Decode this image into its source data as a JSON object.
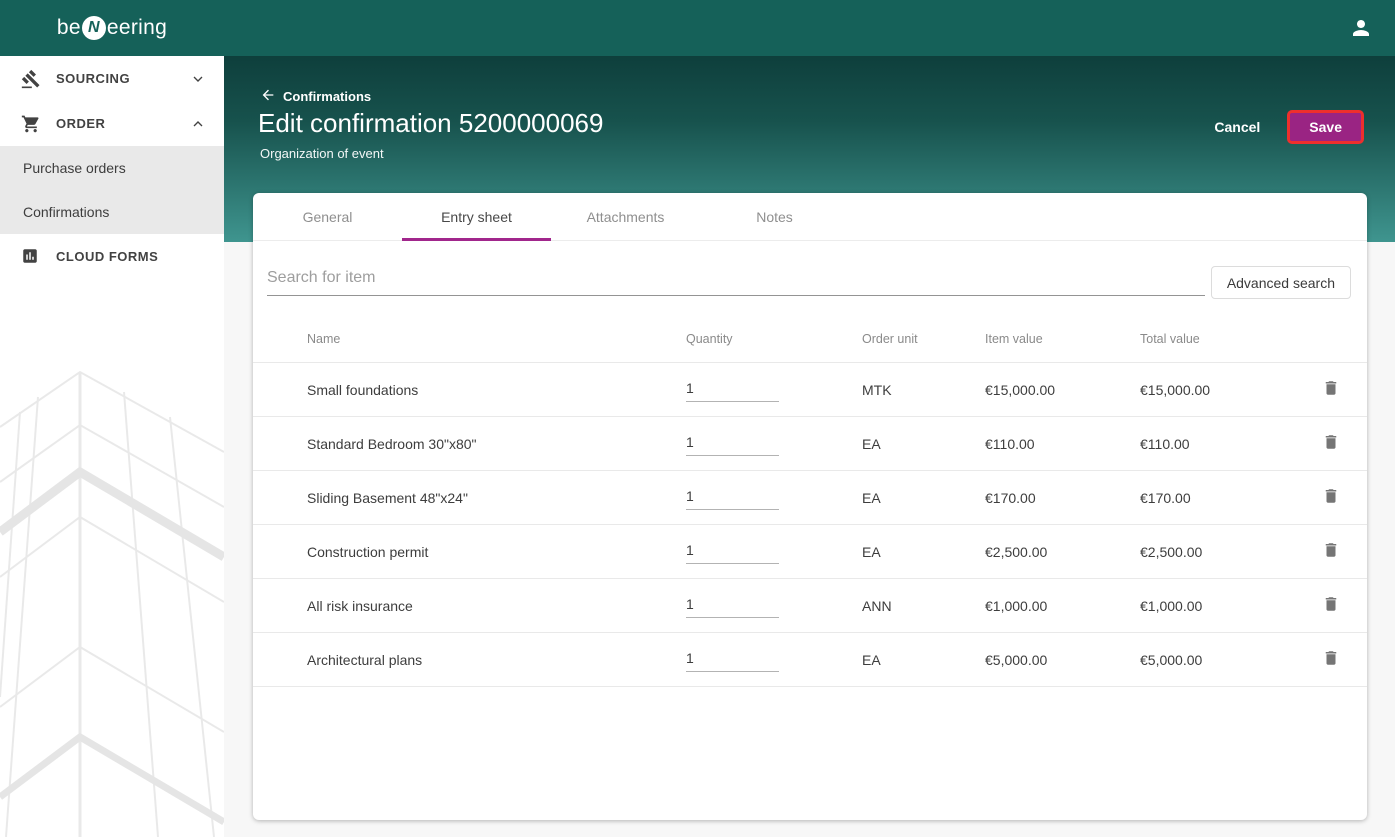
{
  "topbar": {
    "logo_pre": "be",
    "logo_mid": "N",
    "logo_post": "eering"
  },
  "sidebar": {
    "sourcing_label": "SOURCING",
    "order_label": "ORDER",
    "purchase_orders_label": "Purchase orders",
    "confirmations_label": "Confirmations",
    "cloud_forms_label": "CLOUD FORMS"
  },
  "header": {
    "back_label": "Confirmations",
    "title": "Edit confirmation 5200000069",
    "subtitle": "Organization of event",
    "cancel_label": "Cancel",
    "save_label": "Save"
  },
  "tabs": [
    {
      "label": "General",
      "active": false
    },
    {
      "label": "Entry sheet",
      "active": true
    },
    {
      "label": "Attachments",
      "active": false
    },
    {
      "label": "Notes",
      "active": false
    }
  ],
  "search": {
    "placeholder": "Search for item",
    "advanced_label": "Advanced search"
  },
  "table": {
    "columns": [
      "Name",
      "Quantity",
      "Order unit",
      "Item value",
      "Total value"
    ],
    "rows": [
      {
        "name": "Small foundations",
        "quantity": "1",
        "order_unit": "MTK",
        "item_value": "€15,000.00",
        "total_value": "€15,000.00"
      },
      {
        "name": "Standard Bedroom 30\"x80\"",
        "quantity": "1",
        "order_unit": "EA",
        "item_value": "€110.00",
        "total_value": "€110.00"
      },
      {
        "name": "Sliding Basement 48\"x24\"",
        "quantity": "1",
        "order_unit": "EA",
        "item_value": "€170.00",
        "total_value": "€170.00"
      },
      {
        "name": "Construction permit",
        "quantity": "1",
        "order_unit": "EA",
        "item_value": "€2,500.00",
        "total_value": "€2,500.00"
      },
      {
        "name": "All risk insurance",
        "quantity": "1",
        "order_unit": "ANN",
        "item_value": "€1,000.00",
        "total_value": "€1,000.00"
      },
      {
        "name": "Architectural plans",
        "quantity": "1",
        "order_unit": "EA",
        "item_value": "€5,000.00",
        "total_value": "€5,000.00"
      }
    ]
  },
  "icons": {
    "sourcing": "gavel-icon",
    "order": "cart-icon",
    "cloud_forms": "bar-chart-icon",
    "account": "person-icon",
    "back": "arrow-left-icon",
    "delete": "trash-icon",
    "sourcing_chevron": "chevron-down-icon",
    "order_chevron": "chevron-up-icon"
  },
  "colors": {
    "topbar_teal": "#156159",
    "header_gradient_top": "#0e3f3c",
    "header_gradient_bottom": "#3f958f",
    "accent_magenta": "#a1268c",
    "save_fill": "#9a2483",
    "save_border_red": "#ee2f2d",
    "page_background": "#f7f7f7",
    "submenu_background": "#e9e9e9",
    "row_divider": "#e9e9e9"
  }
}
